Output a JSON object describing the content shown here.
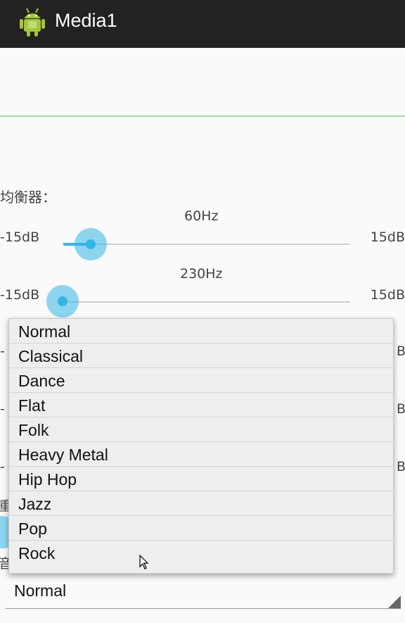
{
  "app": {
    "title": "Media1",
    "icon": "android-robot-icon"
  },
  "equalizer": {
    "label": "均衡器：",
    "min_label": "-15dB",
    "max_label": "15dB",
    "bands": [
      {
        "freq": "60Hz",
        "level_fraction": 0.1
      },
      {
        "freq": "230Hz",
        "level_fraction": 0.0
      }
    ]
  },
  "obscured": {
    "dash_1": "-",
    "dash_2": "-",
    "dash_3": "-",
    "db_partial_1": "B",
    "db_partial_2": "B",
    "db_partial_3": "B",
    "label_partial_1": "重",
    "label_partial_2": "音"
  },
  "preset_dropdown": {
    "options": [
      "Normal",
      "Classical",
      "Dance",
      "Flat",
      "Folk",
      "Heavy Metal",
      "Hip Hop",
      "Jazz",
      "Pop",
      "Rock"
    ]
  },
  "preset_spinner": {
    "selected": "Normal"
  },
  "colors": {
    "accent": "#33b5e5",
    "visualizer_line": "#99e699",
    "action_bar": "#222222"
  }
}
